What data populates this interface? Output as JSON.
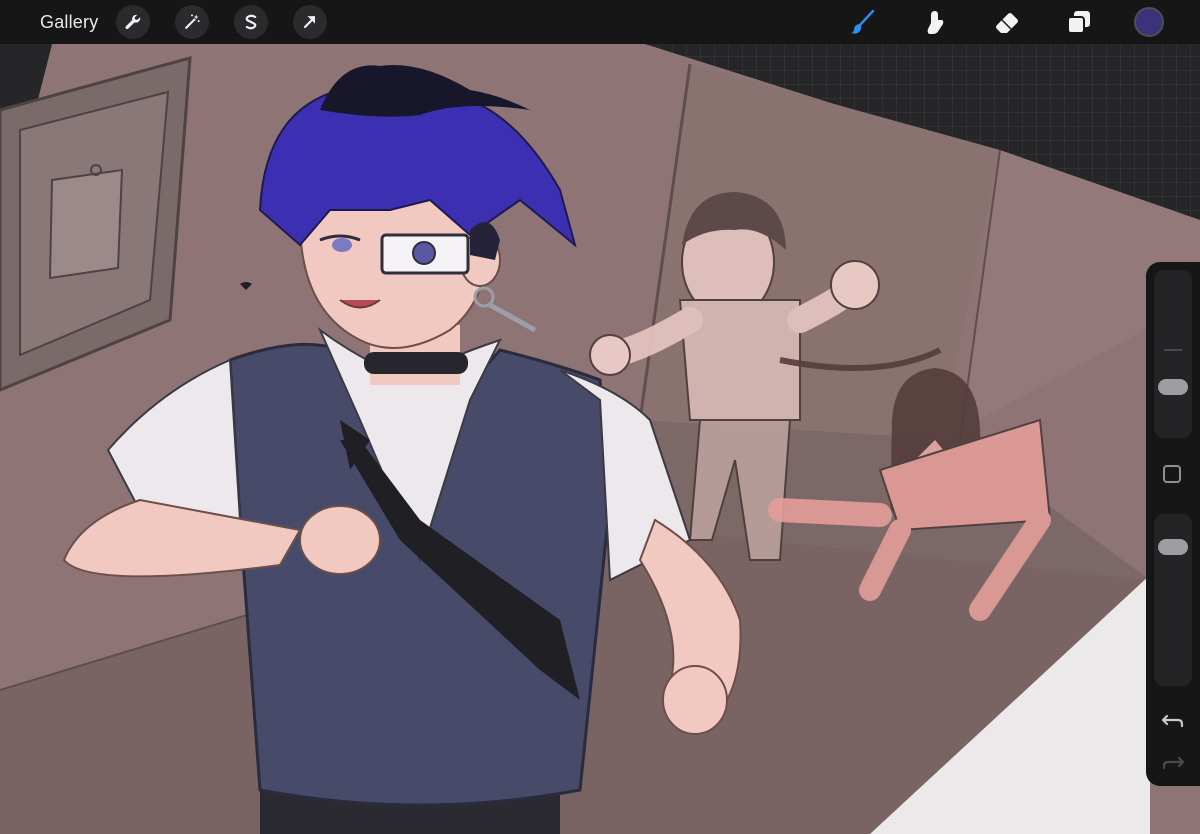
{
  "app": {
    "gallery_label": "Gallery"
  },
  "toolbar": {
    "left_tools": [
      {
        "icon": "wrench-icon",
        "name": "actions-button"
      },
      {
        "icon": "magic-wand-icon",
        "name": "adjustments-button"
      },
      {
        "icon": "selection-s-icon",
        "name": "selection-button"
      },
      {
        "icon": "arrow-cursor-icon",
        "name": "transform-button"
      }
    ],
    "right_tools": [
      {
        "icon": "brush-icon",
        "name": "brush-tool",
        "active": true
      },
      {
        "icon": "smudge-icon",
        "name": "smudge-tool",
        "active": false
      },
      {
        "icon": "eraser-icon",
        "name": "eraser-tool",
        "active": false
      },
      {
        "icon": "layers-icon",
        "name": "layers-button",
        "active": false
      }
    ],
    "current_color": "#3b3379",
    "active_tool_color": "#2f8cf0"
  },
  "sidebar": {
    "brush_size_level": 0.27,
    "brush_opacity_level": 0.86,
    "icons": [
      "modify-square-icon",
      "undo-icon",
      "redo-icon"
    ]
  }
}
